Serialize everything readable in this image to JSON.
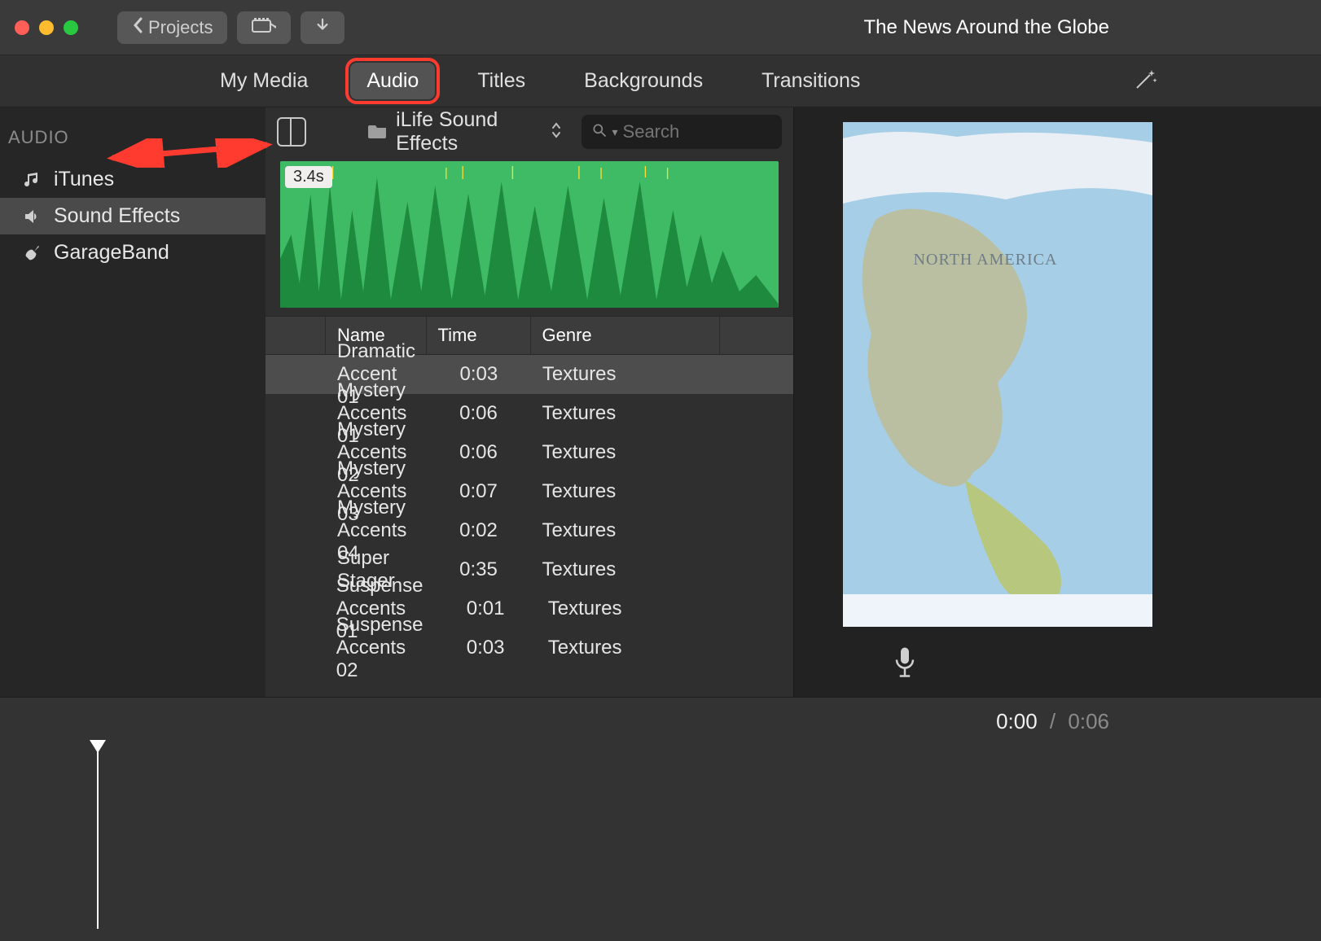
{
  "window": {
    "title": "The News Around the Globe"
  },
  "toolbar": {
    "projects_label": "Projects"
  },
  "tabs": {
    "items": [
      {
        "label": "My Media"
      },
      {
        "label": "Audio"
      },
      {
        "label": "Titles"
      },
      {
        "label": "Backgrounds"
      },
      {
        "label": "Transitions"
      }
    ],
    "selected_index": 1
  },
  "sidebar": {
    "header": "AUDIO",
    "items": [
      {
        "label": "iTunes",
        "icon": "music-note-icon"
      },
      {
        "label": "Sound Effects",
        "icon": "speaker-icon"
      },
      {
        "label": "GarageBand",
        "icon": "guitar-icon"
      }
    ],
    "selected_index": 1
  },
  "browser": {
    "source": "iLife Sound Effects",
    "search_placeholder": "Search",
    "waveform": {
      "duration_label": "3.4s"
    },
    "columns": {
      "name": "Name",
      "time": "Time",
      "genre": "Genre"
    },
    "rows": [
      {
        "name": "Dramatic Accent 01",
        "time": "0:03",
        "genre": "Textures"
      },
      {
        "name": "Mystery Accents 01",
        "time": "0:06",
        "genre": "Textures"
      },
      {
        "name": "Mystery Accents 02",
        "time": "0:06",
        "genre": "Textures"
      },
      {
        "name": "Mystery Accents 03",
        "time": "0:07",
        "genre": "Textures"
      },
      {
        "name": "Mystery Accents 04",
        "time": "0:02",
        "genre": "Textures"
      },
      {
        "name": "Super Stager",
        "time": "0:35",
        "genre": "Textures"
      },
      {
        "name": "Suspense Accents 01",
        "time": "0:01",
        "genre": "Textures"
      },
      {
        "name": "Suspense Accents 02",
        "time": "0:03",
        "genre": "Textures"
      }
    ],
    "selected_row_index": 0
  },
  "preview": {
    "map_label": "NORTH AMERICA"
  },
  "timeline": {
    "current": "0:00",
    "duration": "0:06"
  },
  "colors": {
    "waveform_fill": "#3fbb65",
    "highlight_red": "#ff3b30"
  }
}
